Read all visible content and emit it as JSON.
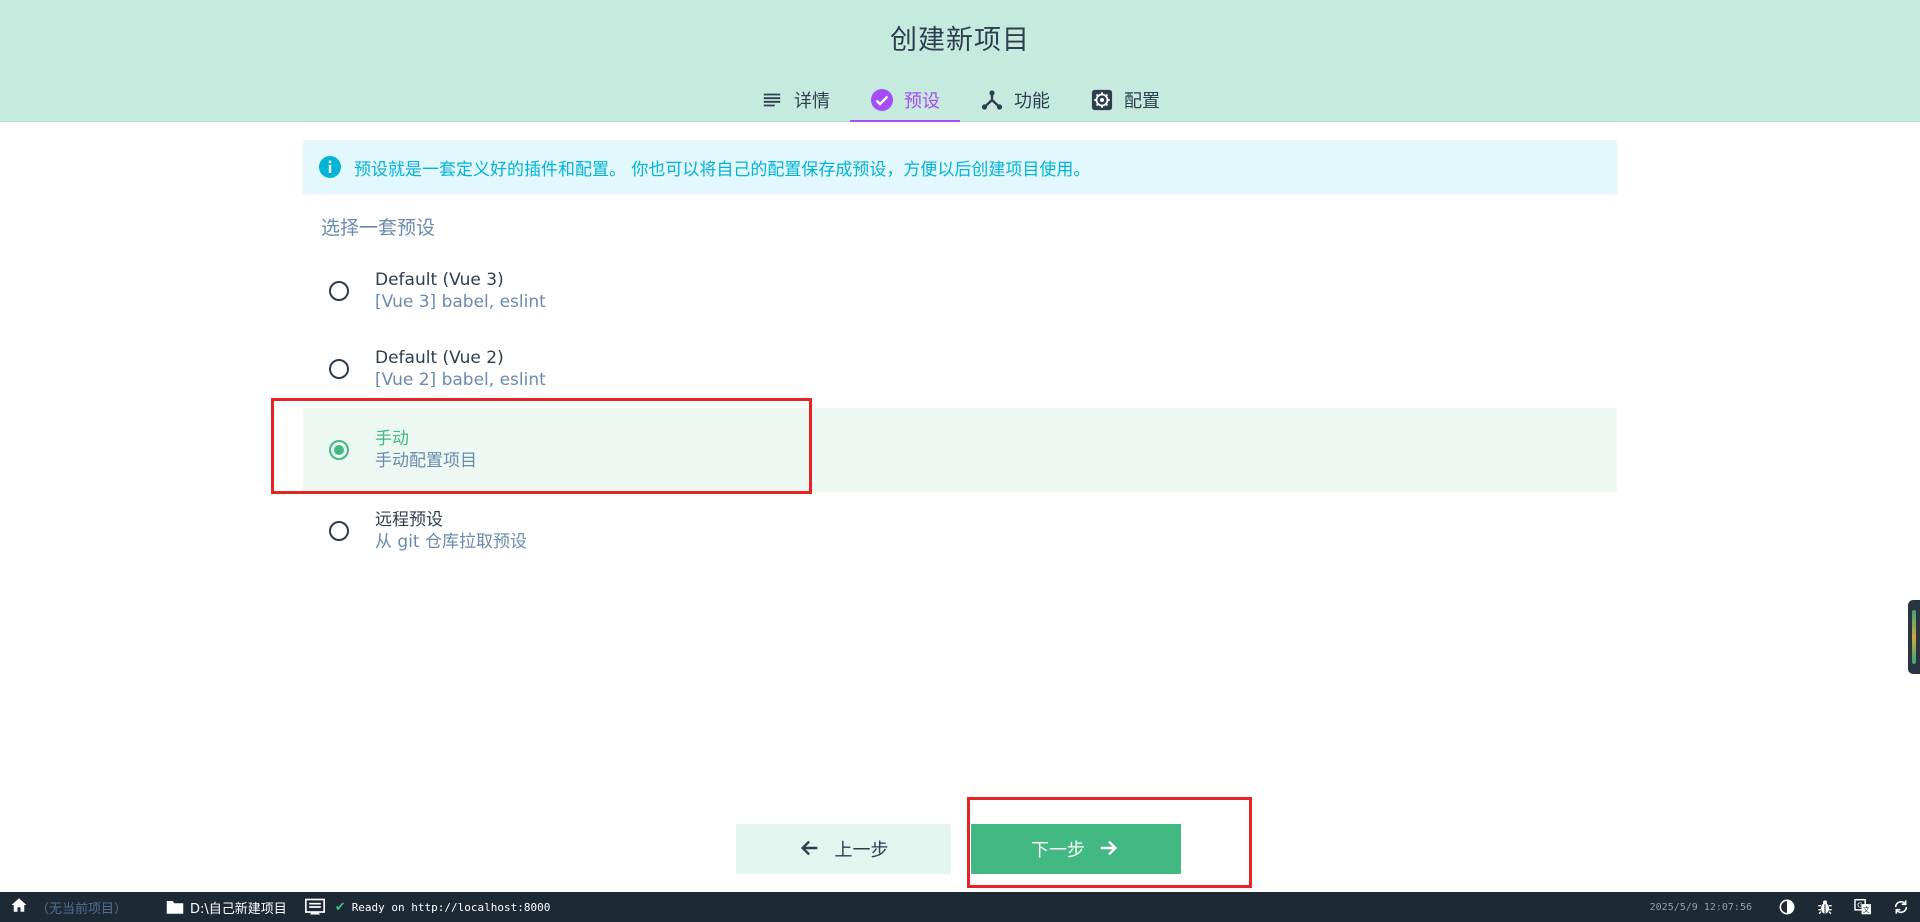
{
  "header": {
    "title": "创建新项目",
    "tabs": [
      {
        "label": "详情",
        "icon": "list-icon",
        "active": false
      },
      {
        "label": "预设",
        "icon": "check-circle-icon",
        "active": true
      },
      {
        "label": "功能",
        "icon": "fork-icon",
        "active": false
      },
      {
        "label": "配置",
        "icon": "gear-icon",
        "active": false
      }
    ]
  },
  "colors": {
    "header_bg": "#c7eadf",
    "accent_purple": "#a44cf6",
    "accent_green": "#42b983",
    "info_text": "#03b3d8",
    "info_bg": "#e2f8fd",
    "annotation_red": "#e82323"
  },
  "info": {
    "icon": "info-icon",
    "text": "预设就是一套定义好的插件和配置。 你也可以将自己的配置保存成预设，方便以后创建项目使用。"
  },
  "presets": {
    "title": "选择一套预设",
    "items": [
      {
        "name": "Default (Vue 3)",
        "desc": "[Vue 3] babel, eslint",
        "selected": false
      },
      {
        "name": "Default (Vue 2)",
        "desc": "[Vue 2] babel, eslint",
        "selected": false
      },
      {
        "name": "手动",
        "desc": "手动配置项目",
        "selected": true
      },
      {
        "name": "远程预设",
        "desc": "从 git 仓库拉取预设",
        "selected": false
      }
    ]
  },
  "actions": {
    "prev_label": "上一步",
    "next_label": "下一步"
  },
  "statusbar": {
    "no_project": "（无当前项目）",
    "path": "D:\\自己新建项目",
    "log": "Ready on http://localhost:8000",
    "datetime": "2025/5/9 12:07:56"
  }
}
